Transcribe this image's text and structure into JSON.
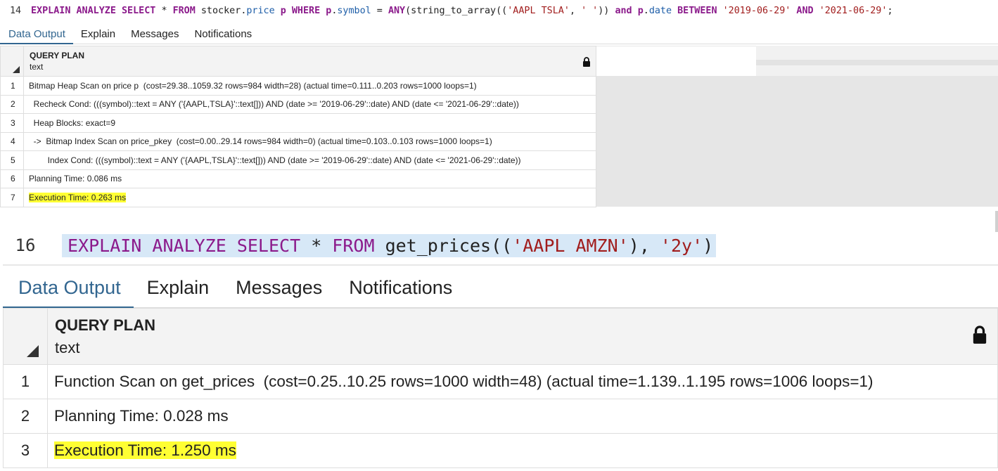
{
  "panel1": {
    "line_number": "14",
    "sql_tokens": [
      {
        "t": "EXPLAIN ANALYZE SELECT ",
        "c": "kw"
      },
      {
        "t": "* ",
        "c": "plain"
      },
      {
        "t": "FROM ",
        "c": "kw"
      },
      {
        "t": "stocker",
        "c": "plain"
      },
      {
        "t": ".",
        "c": "plain"
      },
      {
        "t": "price",
        "c": "fld"
      },
      {
        "t": " p ",
        "c": "kw"
      },
      {
        "t": "WHERE ",
        "c": "kw"
      },
      {
        "t": "p",
        "c": "kw"
      },
      {
        "t": ".",
        "c": "plain"
      },
      {
        "t": "symbol",
        "c": "fld"
      },
      {
        "t": " = ",
        "c": "plain"
      },
      {
        "t": "ANY",
        "c": "kw"
      },
      {
        "t": "(string_to_array((",
        "c": "plain"
      },
      {
        "t": "'AAPL TSLA'",
        "c": "str"
      },
      {
        "t": ", ",
        "c": "plain"
      },
      {
        "t": "' '",
        "c": "str"
      },
      {
        "t": ")) ",
        "c": "plain"
      },
      {
        "t": "and ",
        "c": "kw"
      },
      {
        "t": "p",
        "c": "kw"
      },
      {
        "t": ".",
        "c": "plain"
      },
      {
        "t": "date",
        "c": "fld"
      },
      {
        "t": " BETWEEN ",
        "c": "kw"
      },
      {
        "t": "'2019-06-29'",
        "c": "str"
      },
      {
        "t": " AND ",
        "c": "kw"
      },
      {
        "t": "'2021-06-29'",
        "c": "str"
      },
      {
        "t": ";",
        "c": "plain"
      }
    ],
    "tabs": [
      "Data Output",
      "Explain",
      "Messages",
      "Notifications"
    ],
    "active_tab": 0,
    "column": {
      "name": "QUERY PLAN",
      "type": "text"
    },
    "rows": [
      {
        "n": "1",
        "text": "Bitmap Heap Scan on price p  (cost=29.38..1059.32 rows=984 width=28) (actual time=0.111..0.203 rows=1000 loops=1)"
      },
      {
        "n": "2",
        "text": "  Recheck Cond: (((symbol)::text = ANY ('{AAPL,TSLA}'::text[])) AND (date >= '2019-06-29'::date) AND (date <= '2021-06-29'::date))"
      },
      {
        "n": "3",
        "text": "  Heap Blocks: exact=9"
      },
      {
        "n": "4",
        "text": "  ->  Bitmap Index Scan on price_pkey  (cost=0.00..29.14 rows=984 width=0) (actual time=0.103..0.103 rows=1000 loops=1)"
      },
      {
        "n": "5",
        "text": "        Index Cond: (((symbol)::text = ANY ('{AAPL,TSLA}'::text[])) AND (date >= '2019-06-29'::date) AND (date <= '2021-06-29'::date))"
      },
      {
        "n": "6",
        "text": "Planning Time: 0.086 ms"
      },
      {
        "n": "7",
        "text": "Execution Time: 0.263 ms",
        "highlight": true
      }
    ]
  },
  "panel2": {
    "line_number": "16",
    "sql_tokens": [
      {
        "t": "EXPLAIN ANALYZE SELECT ",
        "c": "kw2"
      },
      {
        "t": "* ",
        "c": "plain"
      },
      {
        "t": "FROM ",
        "c": "kw2"
      },
      {
        "t": "get_prices((",
        "c": "plain"
      },
      {
        "t": "'AAPL AMZN'",
        "c": "str"
      },
      {
        "t": "), ",
        "c": "plain"
      },
      {
        "t": "'2y'",
        "c": "str"
      },
      {
        "t": ")",
        "c": "plain"
      }
    ],
    "tabs": [
      "Data Output",
      "Explain",
      "Messages",
      "Notifications"
    ],
    "active_tab": 0,
    "column": {
      "name": "QUERY PLAN",
      "type": "text"
    },
    "rows": [
      {
        "n": "1",
        "text": "Function Scan on get_prices  (cost=0.25..10.25 rows=1000 width=48) (actual time=1.139..1.195 rows=1006 loops=1)"
      },
      {
        "n": "2",
        "text": "Planning Time: 0.028 ms"
      },
      {
        "n": "3",
        "text": "Execution Time: 1.250 ms",
        "highlight": true
      }
    ]
  },
  "colors": {
    "keyword": "#8b1a8b",
    "string": "#a11d1d",
    "field": "#1e5ea8",
    "active_tab": "#326690",
    "highlight": "#ffff33",
    "selection": "#d7e8f7"
  },
  "icons": {
    "lock": "lock-icon",
    "sort": "sort-indicator-icon"
  }
}
